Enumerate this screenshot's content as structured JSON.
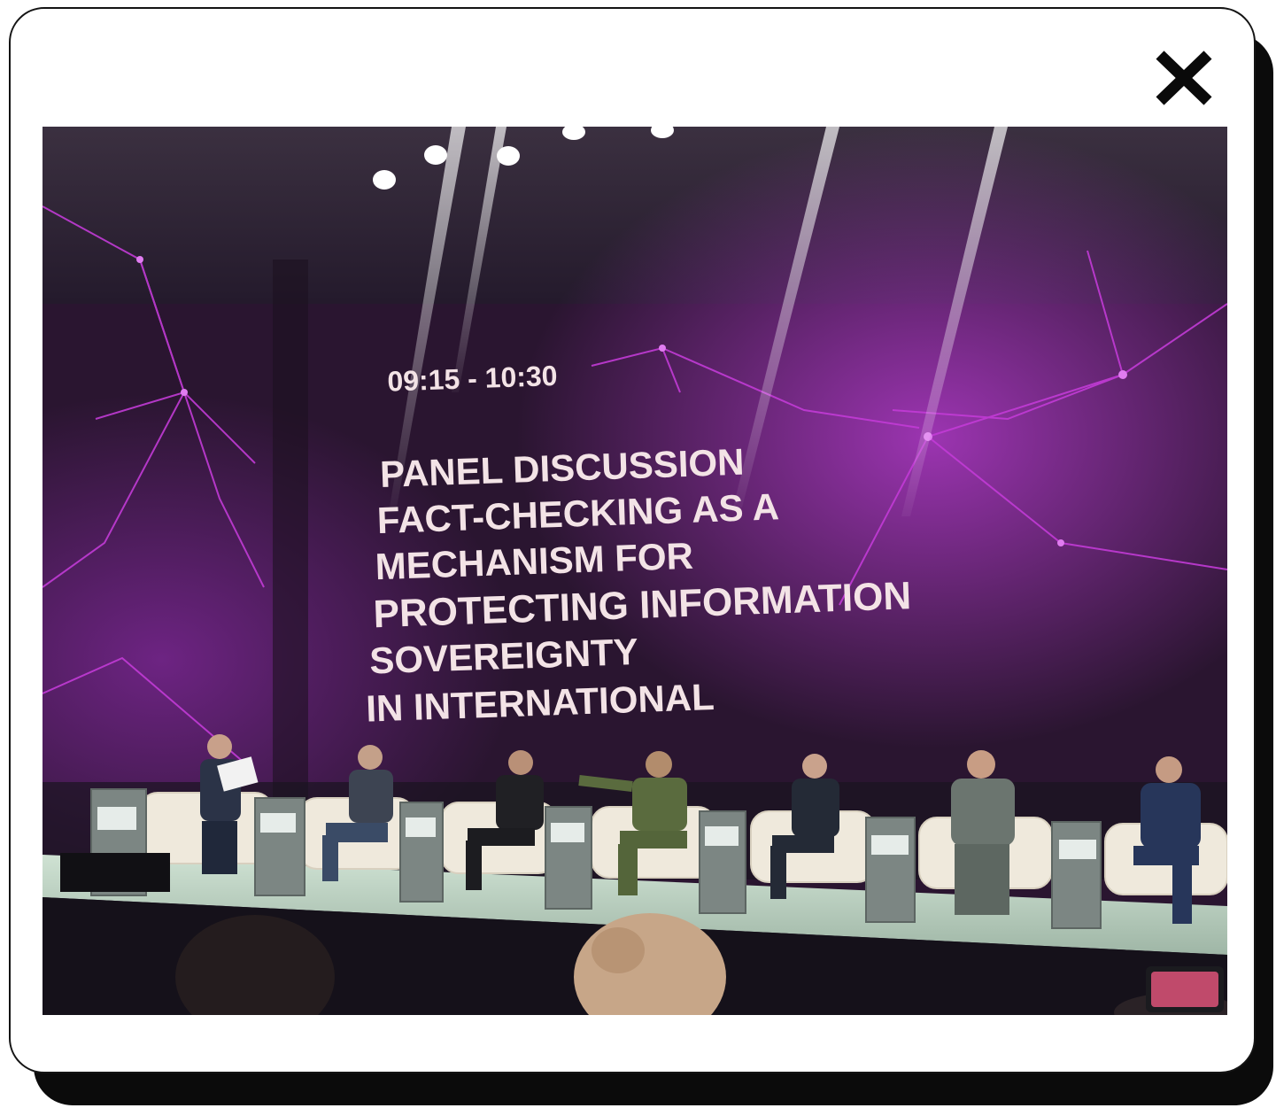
{
  "modal": {
    "close_icon": "close-icon"
  },
  "photo": {
    "screen": {
      "time": "09:15 - 10:30",
      "title_lines": [
        "PANEL DISCUSSION",
        "FACT-CHECKING AS A",
        "MECHANISM FOR",
        "PROTECTING INFORMATION",
        "SOVEREIGNTY",
        "IN INTERNATIONAL"
      ]
    },
    "colors": {
      "screen_background": "#2a1530",
      "accent_magenta": "#c23bd6",
      "stage_floor": "#c9dccd",
      "text": "#f3e3e6"
    }
  }
}
